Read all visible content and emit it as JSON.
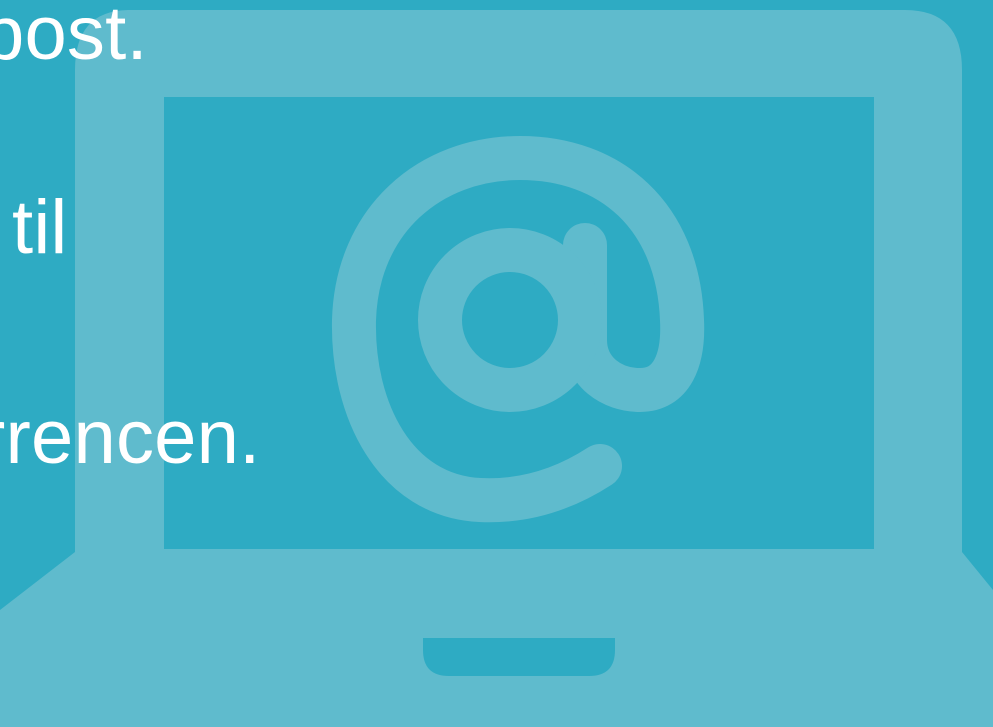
{
  "slide": {
    "background_color": "#2eabc3",
    "illustration": {
      "icon": "laptop-email-icon",
      "color": "#5fbbcd"
    },
    "text_lines": [
      "post.",
      "til",
      "rrencen."
    ]
  }
}
